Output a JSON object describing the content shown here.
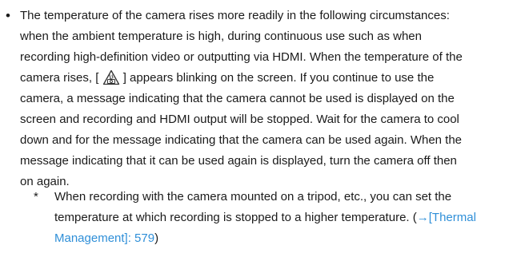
{
  "bullet": {
    "marker": "•",
    "lines": [
      "The temperature of the camera rises more readily in the following circumstances:",
      "when the ambient temperature is high, during continuous use such as when",
      "recording high-definition video or outputting via HDMI. When the temperature of the",
      "camera rises, [",
      "] appears blinking on the screen. If you continue to use the",
      "camera, a message indicating that the camera cannot be used is displayed on the",
      "screen and recording and HDMI output will be stopped. Wait for the camera to cool",
      "down and for the message indicating that the camera can be used again. When the",
      "message indicating that it can be used again is displayed, turn the camera off then",
      "on again."
    ],
    "icon": "camera-overheat-warning-icon"
  },
  "note": {
    "marker": "*",
    "line1": "When recording with the camera mounted on a tripod, etc., you can set the",
    "line2_text": "temperature at which recording is stopped to a higher temperature. (",
    "line2_link": "→[Thermal",
    "line3_link": "Management]: 579",
    "line3_text": ")",
    "link_color": "#2f8fd8"
  }
}
